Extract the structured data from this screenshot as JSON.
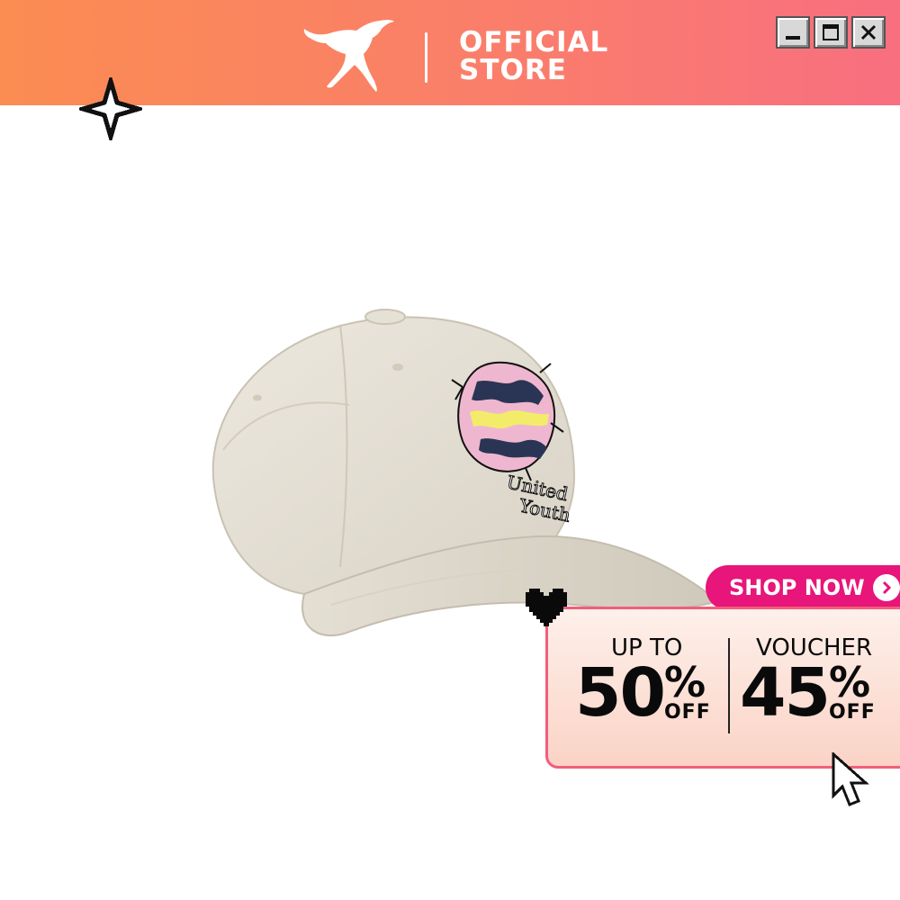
{
  "header": {
    "brand_logo": "puma-cat-logo",
    "store_line1": "OFFICIAL",
    "store_line2": "STORE",
    "window_controls": [
      "minimize-icon",
      "maximize-icon",
      "close-icon"
    ]
  },
  "product": {
    "embroidery_line1": "United",
    "embroidery_line2": "Youth"
  },
  "cta": {
    "label": "SHOP NOW",
    "icon": "chevron-right-icon"
  },
  "promo": {
    "left": {
      "label": "UP TO",
      "value": "50",
      "percent": "%",
      "suffix": "OFF"
    },
    "right": {
      "label": "VOUCHER",
      "value": "45",
      "percent": "%",
      "suffix": "OFF"
    }
  },
  "decorations": [
    "sparkle-icon",
    "heart-icon",
    "cursor-icon"
  ],
  "colors": {
    "header_start": "#fb8c52",
    "header_end": "#f86f80",
    "cta_bg": "#e8157a",
    "promo_border": "#f25e7a",
    "cap_color": "#e7e2d6"
  }
}
